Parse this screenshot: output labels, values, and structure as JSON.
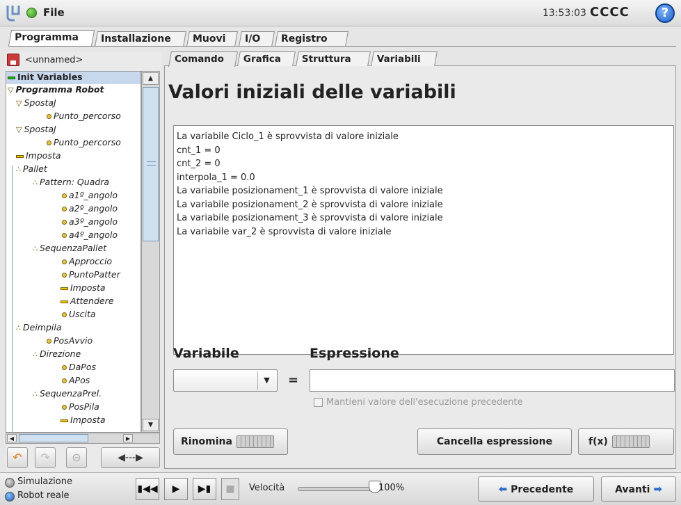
{
  "header": {
    "file_label": "File",
    "clock": "13:53:03",
    "robot_name": "CCCC",
    "help_glyph": "?"
  },
  "main_tabs": [
    {
      "label": "Programma",
      "active": true
    },
    {
      "label": "Installazione",
      "active": false
    },
    {
      "label": "Muovi",
      "active": false
    },
    {
      "label": "I/O",
      "active": false
    },
    {
      "label": "Registro",
      "active": false
    }
  ],
  "program": {
    "name": "<unnamed>"
  },
  "tree": [
    {
      "label": "Init Variables",
      "icon": "init-icon",
      "depth": 0,
      "selected": true,
      "bold": true
    },
    {
      "label": "Programma Robot",
      "icon": "expand-triangle-icon",
      "depth": 0,
      "bold": true
    },
    {
      "label": "SpostaJ",
      "icon": "expand-triangle-icon",
      "depth": 1
    },
    {
      "label": "Punto_percorso",
      "icon": "waypoint-icon",
      "depth": 2
    },
    {
      "label": "SpostaJ",
      "icon": "expand-triangle-icon",
      "depth": 1
    },
    {
      "label": "Punto_percorso",
      "icon": "waypoint-icon",
      "depth": 2
    },
    {
      "label": "Imposta",
      "icon": "set-icon",
      "depth": 1
    },
    {
      "label": "Pallet",
      "icon": "pallet-icon",
      "depth": 1
    },
    {
      "label": "Pattern: Quadra",
      "icon": "pallet-icon",
      "depth": 2
    },
    {
      "label": "a1º_angolo",
      "icon": "waypoint-icon",
      "depth": 3
    },
    {
      "label": "a2º_angolo",
      "icon": "waypoint-icon",
      "depth": 3
    },
    {
      "label": "a3º_angolo",
      "icon": "waypoint-icon",
      "depth": 3
    },
    {
      "label": "a4º_angolo",
      "icon": "waypoint-icon",
      "depth": 3
    },
    {
      "label": "SequenzaPallet",
      "icon": "pallet-icon",
      "depth": 2
    },
    {
      "label": "Approccio",
      "icon": "waypoint-icon",
      "depth": 3
    },
    {
      "label": "PuntoPatter",
      "icon": "waypoint-icon",
      "depth": 3
    },
    {
      "label": "Imposta",
      "icon": "set-icon",
      "depth": 3
    },
    {
      "label": "Attendere",
      "icon": "set-icon",
      "depth": 3
    },
    {
      "label": "Uscita",
      "icon": "waypoint-icon",
      "depth": 3
    },
    {
      "label": "Deimpila",
      "icon": "pallet-icon",
      "depth": 1
    },
    {
      "label": "PosAvvio",
      "icon": "waypoint-icon",
      "depth": 2
    },
    {
      "label": "Direzione",
      "icon": "pallet-icon",
      "depth": 2
    },
    {
      "label": "DaPos",
      "icon": "waypoint-icon",
      "depth": 3
    },
    {
      "label": "APos",
      "icon": "waypoint-icon",
      "depth": 3
    },
    {
      "label": "SequenzaPrel.",
      "icon": "pallet-icon",
      "depth": 2
    },
    {
      "label": "PosPila",
      "icon": "waypoint-icon",
      "depth": 3
    },
    {
      "label": "Imposta",
      "icon": "set-icon",
      "depth": 3
    }
  ],
  "sub_tabs": [
    {
      "label": "Comando",
      "active": true
    },
    {
      "label": "Grafica",
      "active": false
    },
    {
      "label": "Struttura",
      "active": false
    },
    {
      "label": "Variabili",
      "active": false
    }
  ],
  "main": {
    "title": "Valori iniziali delle variabili",
    "variables": [
      "La variabile Ciclo_1 è sprovvista di valore iniziale",
      "cnt_1 = 0",
      "cnt_2 = 0",
      "interpola_1 = 0.0",
      "La variabile posizionament_1 è sprovvista di valore iniziale",
      "La variabile posizionament_2 è sprovvista di valore iniziale",
      "La variabile posizionament_3 è sprovvista di valore iniziale",
      "La variabile var_2 è sprovvista di valore iniziale"
    ],
    "variable_label": "Variabile",
    "expression_label": "Espressione",
    "equals": "=",
    "variable_value": "",
    "expression_value": "",
    "keep_value_label": "Mantieni valore dell'esecuzione precedente",
    "rename_label": "Rinomina",
    "clear_expression_label": "Cancella espressione",
    "fx_label": "f(x)"
  },
  "footer": {
    "simulation_label": "Simulazione",
    "real_robot_label": "Robot reale",
    "speed_label": "Velocità",
    "speed_value": "100%",
    "speed_fraction": 1.0,
    "prev_label": "Precedente",
    "next_label": "Avanti"
  }
}
